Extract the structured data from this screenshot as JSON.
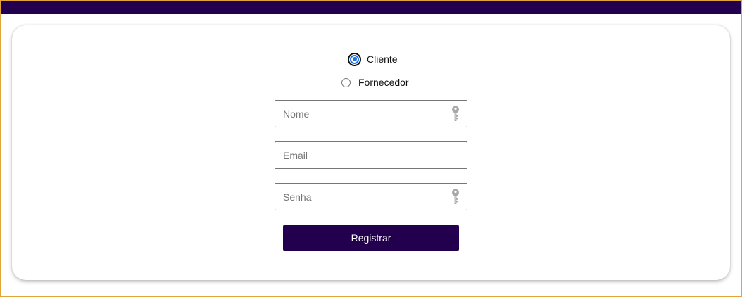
{
  "colors": {
    "brand": "#23004d",
    "radio_accent": "#1a73e8",
    "frame_border": "#e2a437"
  },
  "account_type": {
    "options": [
      {
        "label": "Cliente",
        "selected": true
      },
      {
        "label": "Fornecedor",
        "selected": false
      }
    ]
  },
  "form": {
    "nome": {
      "placeholder": "Nome",
      "value": "",
      "icon": "key-icon"
    },
    "email": {
      "placeholder": "Email",
      "value": ""
    },
    "senha": {
      "placeholder": "Senha",
      "value": "",
      "icon": "key-icon"
    },
    "submit_label": "Registrar"
  }
}
